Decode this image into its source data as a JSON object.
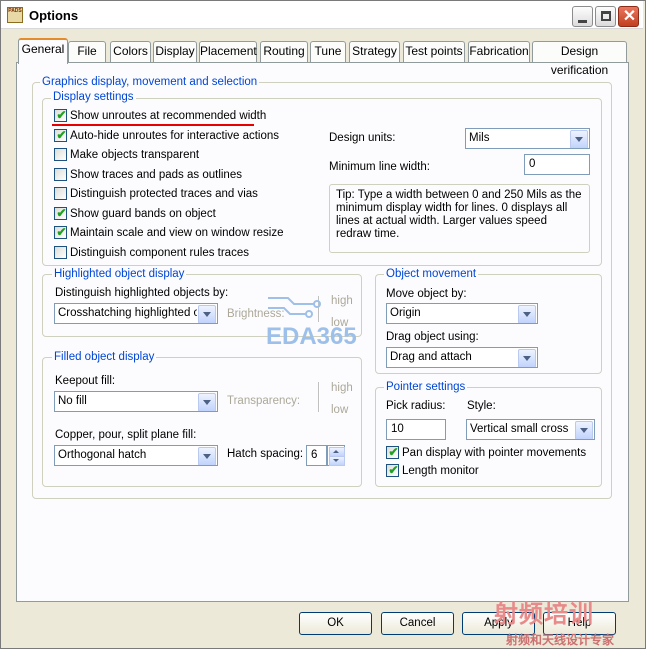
{
  "window": {
    "title": "Options",
    "app_icon_text": "PADS"
  },
  "tabs": [
    "General",
    "File",
    "Colors",
    "Display",
    "Placement",
    "Routing",
    "Tune",
    "Strategy",
    "Test points",
    "Fabrication",
    "Design verification"
  ],
  "graphics_group": {
    "title": "Graphics display, movement and selection",
    "display_settings": {
      "title": "Display settings",
      "checkboxes": [
        {
          "label": "Show unroutes at recommended width",
          "checked": true
        },
        {
          "label": "Auto-hide unroutes for interactive actions",
          "checked": true
        },
        {
          "label": "Make objects transparent",
          "checked": false
        },
        {
          "label": "Show traces and pads as outlines",
          "checked": false
        },
        {
          "label": "Distinguish protected traces and vias",
          "checked": false
        },
        {
          "label": "Show guard bands on object",
          "checked": true
        },
        {
          "label": "Maintain scale and view on window resize",
          "checked": true
        },
        {
          "label": "Distinguish component rules traces",
          "checked": false
        }
      ],
      "design_units_label": "Design units:",
      "design_units_value": "Mils",
      "min_line_width_label": "Minimum line width:",
      "min_line_width_value": "0",
      "tip": "Tip: Type a width between 0 and 250 Mils as the minimum display width for lines. 0 displays all lines at actual width. Larger values speed redraw time."
    },
    "highlighted": {
      "title": "Highlighted object display",
      "distinguish_label": "Distinguish highlighted objects by:",
      "distinguish_value": "Crosshatching highlighted objects",
      "brightness_label": "Brightness:",
      "high_label": "high",
      "low_label": "low"
    },
    "filled": {
      "title": "Filled object display",
      "keepout_label": "Keepout fill:",
      "keepout_value": "No fill",
      "transparency_label": "Transparency:",
      "high_label": "high",
      "low_label": "low",
      "copper_label": "Copper, pour, split plane fill:",
      "copper_value": "Orthogonal hatch",
      "hatch_label": "Hatch spacing:",
      "hatch_value": "6"
    },
    "movement": {
      "title": "Object movement",
      "move_label": "Move object by:",
      "move_value": "Origin",
      "drag_label": "Drag object using:",
      "drag_value": "Drag and attach"
    },
    "pointer": {
      "title": "Pointer settings",
      "pick_label": "Pick radius:",
      "pick_value": "10",
      "style_label": "Style:",
      "style_value": "Vertical small cross",
      "pan_label": "Pan display with pointer movements",
      "pan_checked": true,
      "length_label": "Length monitor",
      "length_checked": true
    }
  },
  "buttons": {
    "ok": "OK",
    "cancel": "Cancel",
    "apply": "Apply",
    "help": "Help"
  },
  "watermarks": {
    "eda": "EDA365",
    "cn_top": "射频培训",
    "cn_bottom": "射频和天线设计专家"
  },
  "colors": {
    "accent_blue": "#0046d5",
    "annotation_red": "#e60000",
    "tab_highlight": "#e68b2c"
  }
}
